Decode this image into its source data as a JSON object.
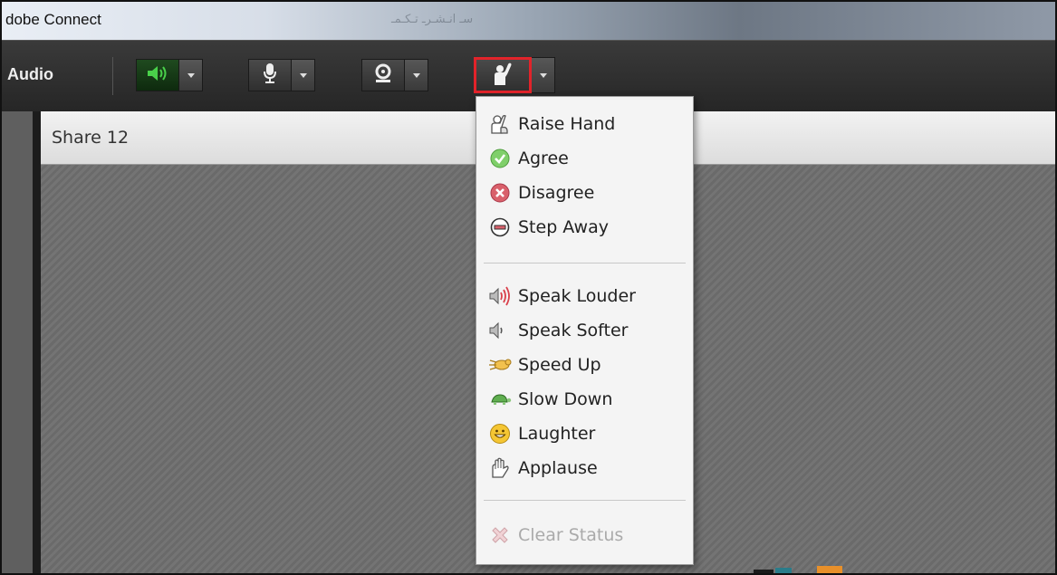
{
  "window": {
    "title": "dobe Connect",
    "title_rtl": "سـ انـشـرـ تـكـمـ"
  },
  "toolbar": {
    "audio_label": "Audio",
    "speaker": {
      "icon": "speaker-icon",
      "state": "on"
    },
    "microphone": {
      "icon": "microphone-icon"
    },
    "camera": {
      "icon": "webcam-icon"
    },
    "status": {
      "icon": "raise-hand-icon",
      "highlighted": true
    }
  },
  "pod": {
    "title": "Share 12"
  },
  "status_menu": {
    "groups": [
      [
        {
          "label": "Raise Hand",
          "icon": "raise-hand-icon"
        },
        {
          "label": "Agree",
          "icon": "agree-check-icon"
        },
        {
          "label": "Disagree",
          "icon": "disagree-x-icon"
        },
        {
          "label": "Step Away",
          "icon": "step-away-icon"
        }
      ],
      [
        {
          "label": "Speak Louder",
          "icon": "speak-louder-icon"
        },
        {
          "label": "Speak Softer",
          "icon": "speak-softer-icon"
        },
        {
          "label": "Speed Up",
          "icon": "speed-up-icon"
        },
        {
          "label": "Slow Down",
          "icon": "slow-down-turtle-icon"
        },
        {
          "label": "Laughter",
          "icon": "laughter-icon"
        },
        {
          "label": "Applause",
          "icon": "applause-icon"
        }
      ],
      [
        {
          "label": "Clear Status",
          "icon": "clear-status-icon",
          "disabled": true
        }
      ]
    ]
  },
  "colors": {
    "accent_highlight": "#e2232a",
    "speaker_on": "#49d14a"
  }
}
